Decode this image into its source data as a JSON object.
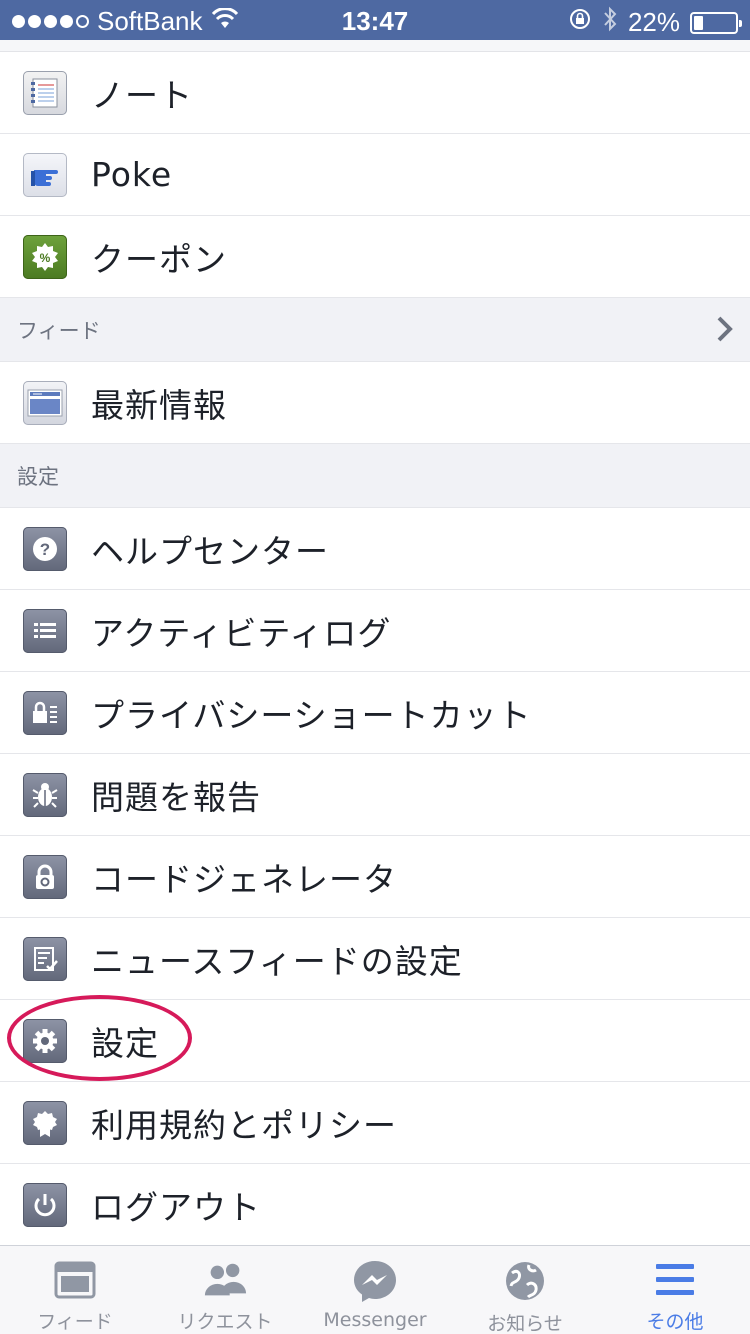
{
  "status_bar": {
    "carrier": "SoftBank",
    "time": "13:47",
    "battery_percent": "22%",
    "battery_level": 0.22
  },
  "menu": {
    "items_top": [
      {
        "label": "ノート",
        "icon": "notebook-icon"
      },
      {
        "label": "Poke",
        "icon": "poke-hand-icon"
      },
      {
        "label": "クーポン",
        "icon": "coupon-icon"
      }
    ],
    "feed_section": {
      "header": "フィード",
      "items": [
        {
          "label": "最新情報",
          "icon": "news-feed-icon"
        }
      ]
    },
    "settings_section": {
      "header": "設定",
      "items": [
        {
          "label": "ヘルプセンター",
          "icon": "help-icon"
        },
        {
          "label": "アクティビティログ",
          "icon": "activity-log-icon"
        },
        {
          "label": "プライバシーショートカット",
          "icon": "privacy-lock-icon"
        },
        {
          "label": "問題を報告",
          "icon": "bug-icon"
        },
        {
          "label": "コードジェネレータ",
          "icon": "code-generator-lock-icon"
        },
        {
          "label": "ニュースフィードの設定",
          "icon": "news-feed-settings-icon"
        },
        {
          "label": "設定",
          "icon": "gear-icon"
        },
        {
          "label": "利用規約とポリシー",
          "icon": "terms-badge-icon"
        },
        {
          "label": "ログアウト",
          "icon": "power-icon"
        }
      ]
    }
  },
  "tab_bar": {
    "tabs": [
      {
        "label": "フィード",
        "icon": "feed-icon",
        "active": false
      },
      {
        "label": "リクエスト",
        "icon": "friends-icon",
        "active": false
      },
      {
        "label": "Messenger",
        "icon": "messenger-icon",
        "active": false
      },
      {
        "label": "お知らせ",
        "icon": "globe-icon",
        "active": false
      },
      {
        "label": "その他",
        "icon": "hamburger-menu-icon",
        "active": true
      }
    ]
  },
  "colors": {
    "status_bar_bg": "#4e69a2",
    "active_tab": "#4a7ce6",
    "highlight_circle": "#d61a5a"
  }
}
